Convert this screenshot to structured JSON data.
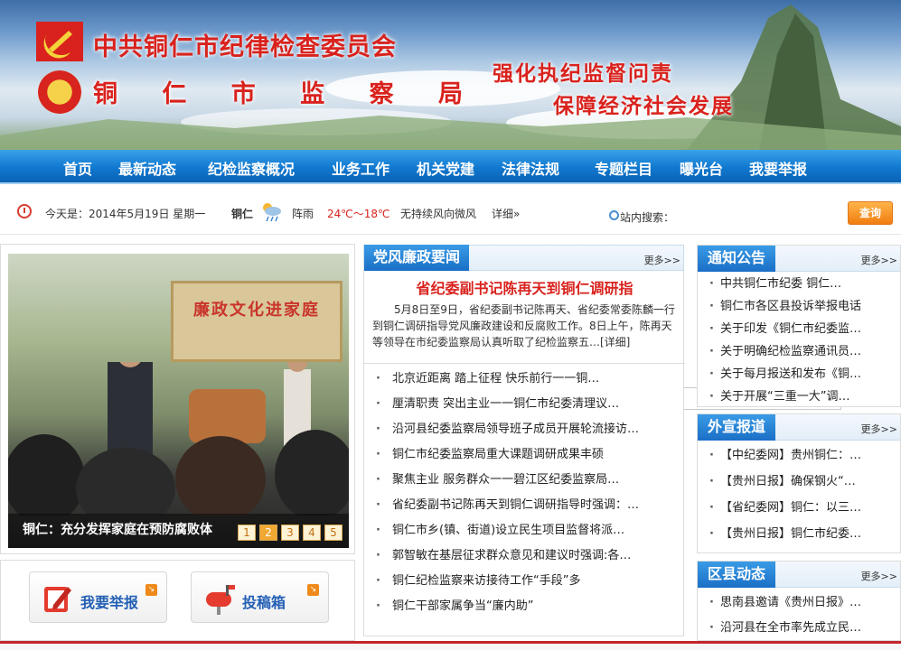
{
  "header": {
    "title_cpc": "中共铜仁市纪律检查委员会",
    "title_bureau": "铜 仁 市 监 察 局",
    "slogan_line1": "强化执纪监督问责",
    "slogan_line2": "保障经济社会发展"
  },
  "nav": {
    "items": [
      "首页",
      "最新动态",
      "纪检监察概况",
      "业务工作",
      "机关党建",
      "法律法规",
      "专题栏目",
      "曝光台",
      "我要举报"
    ]
  },
  "infobar": {
    "date": "今天是：2014年5月19日  星期一",
    "city": "铜仁",
    "weather": "阵雨",
    "temp": "24℃～18℃",
    "wind": "无持续风向微风",
    "detail": "详细»",
    "search_label": "站内搜索：",
    "search_value": "",
    "search_button": "查询"
  },
  "slideshow": {
    "board_text": "廉政文化进家庭",
    "caption": "铜仁：充分发挥家庭在预防腐败体",
    "pages": [
      "1",
      "2",
      "3",
      "4",
      "5"
    ],
    "active_page": 2
  },
  "actions": {
    "report": "我要举报",
    "submit": "投稿箱"
  },
  "party_news": {
    "title": "党风廉政要闻",
    "more": "更多>>",
    "headline": "省纪委副书记陈再天到铜仁调研指",
    "summary": "5月8日至9日，省纪委副书记陈再天、省纪委常委陈麟一行到铜仁调研指导党风廉政建设和反腐败工作。8日上午，陈再天等领导在市纪委监察局认真听取了纪检监察五…[详细]",
    "items": [
      "北京近距离  踏上征程  快乐前行一一铜…",
      "厘清职责  突出主业一一铜仁市纪委清理议…",
      "沿河县纪委监察局领导班子成员开展轮流接访…",
      "铜仁市纪委监察局重大课题调研成果丰硕",
      "聚焦主业  服务群众一一碧江区纪委监察局…",
      "省纪委副书记陈再天到铜仁调研指导时强调：…",
      "铜仁市乡(镇、街道)设立民生项目监督将派…",
      "郭智敏在基层征求群众意见和建议时强调:各…",
      "铜仁纪检监察来访接待工作“手段”多",
      "铜仁干部家属争当“廉内助”"
    ]
  },
  "notices": {
    "title": "通知公告",
    "more": "更多>>",
    "items": [
      "中共铜仁市纪委  铜仁…",
      "铜仁市各区县投诉举报电话",
      "关于印发《铜仁市纪委监…",
      "关于明确纪检监察通讯员…",
      "关于每月报送和发布《铜…",
      "关于开展“三重一大”调…"
    ]
  },
  "external": {
    "title": "外宣报道",
    "more": "更多>>",
    "items": [
      "【中纪委网】贵州铜仁：…",
      "【贵州日报】确保钢火“…",
      "【省纪委网】铜仁：以三…",
      "【贵州日报】铜仁市纪委…"
    ]
  },
  "county": {
    "title": "区县动态",
    "more": "更多>>",
    "items": [
      "思南县邀请《贵州日报》…",
      "沿河县在全市率先成立民…"
    ]
  }
}
